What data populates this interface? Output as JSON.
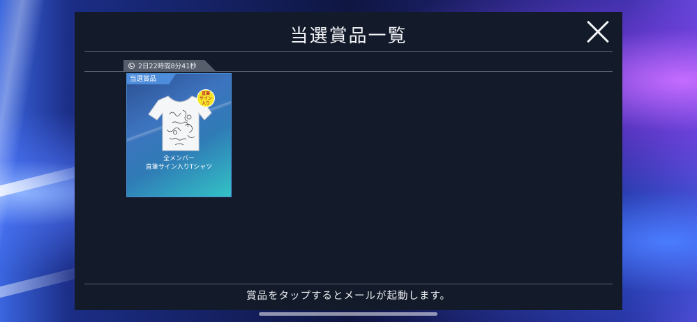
{
  "dialog": {
    "title": "当選賞品一覧",
    "close_icon": "close-icon",
    "timer": {
      "icon": "clock-icon",
      "text": "2日22時間8分41秒"
    },
    "prizes": [
      {
        "label": "当選賞品",
        "badge_lines": [
          "直筆",
          "サイン",
          "入り"
        ],
        "name_line1": "全メンバー",
        "name_line2": "直筆サイン入りTシャツ",
        "image": "t-shirt"
      }
    ],
    "footer_text": "賞品をタップするとメールが起動します。"
  },
  "colors": {
    "dialog_bg": "#131a29",
    "card_border": "#4a8bd4",
    "card_label_bg": "#4d8ddc",
    "badge": "#f5e62a"
  }
}
